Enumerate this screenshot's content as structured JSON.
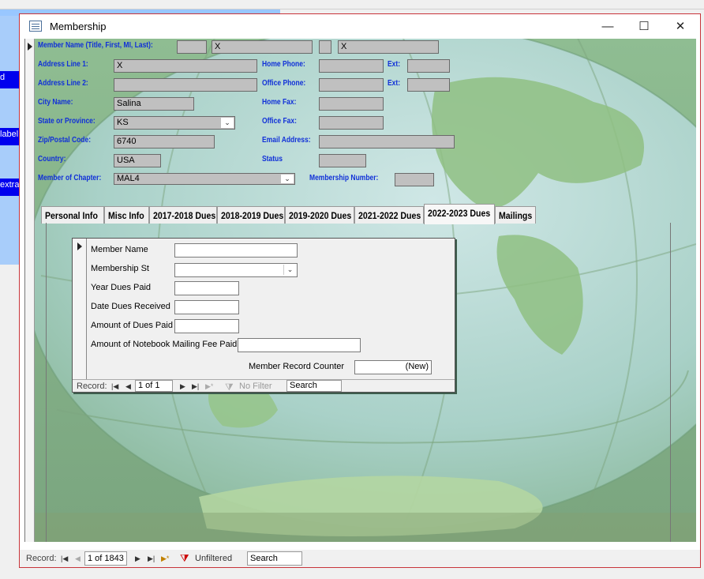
{
  "background_app": {
    "labels": [
      "d",
      "label",
      "extra"
    ]
  },
  "window": {
    "title": "Membership",
    "icon": "form-icon",
    "controls": {
      "minimize": "—",
      "maximize": "☐",
      "close": "✕"
    }
  },
  "form": {
    "fields": {
      "member_name_label": "Member Name (Title, First, MI, Last):",
      "member_name_values": [
        "",
        "X",
        "",
        "X"
      ],
      "address1_label": "Address Line 1:",
      "address1_value": "X",
      "address2_label": "Address Line 2:",
      "address2_value": "",
      "city_label": "City Name:",
      "city_value": "Salina",
      "state_label": "State or Province:",
      "state_value": "KS",
      "zip_label": "Zip/Postal Code:",
      "zip_value": "6740",
      "country_label": "Country:",
      "country_value": "USA",
      "chapter_label": "Member of Chapter:",
      "chapter_value": "MAL4",
      "home_phone_label": "Home Phone:",
      "home_phone_value": "",
      "ext_label": "Ext:",
      "home_ext_value": "",
      "office_phone_label": "Office Phone:",
      "office_phone_value": "",
      "office_ext_value": "",
      "home_fax_label": "Home Fax:",
      "home_fax_value": "",
      "office_fax_label": "Office Fax:",
      "office_fax_value": "",
      "email_label": "Email Address:",
      "email_value": "",
      "status_label": "Status",
      "status_value": "",
      "membership_number_label": "Membership Number:",
      "membership_number_value": ""
    },
    "tabs": [
      {
        "label": "Personal Info"
      },
      {
        "label": "Misc Info"
      },
      {
        "label": "2017-2018 Dues"
      },
      {
        "label": "2018-2019 Dues"
      },
      {
        "label": "2019-2020 Dues"
      },
      {
        "label": "2021-2022 Dues"
      },
      {
        "label": "2022-2023 Dues"
      },
      {
        "label": "Mailings"
      }
    ],
    "active_tab": "2022-2023 Dues",
    "subform": {
      "member_name_label": "Member Name",
      "member_name_value": "",
      "membership_status_label": "Membership St",
      "membership_status_value": "",
      "year_dues_paid_label": "Year Dues Paid",
      "year_dues_paid_value": "",
      "date_dues_received_label": "Date Dues Received",
      "date_dues_received_value": "",
      "amount_dues_paid_label": "Amount of Dues Paid",
      "amount_dues_paid_value": "",
      "notebook_fee_label": "Amount of Notebook Mailing Fee Paid",
      "notebook_fee_value": "",
      "record_counter_label": "Member Record Counter",
      "record_counter_value": "(New)",
      "nav": {
        "record_label": "Record:",
        "position": "1 of 1",
        "filter": "No Filter",
        "search": "Search"
      }
    }
  },
  "main_nav": {
    "record_label": "Record:",
    "position": "1 of 1843",
    "filter": "Unfiltered",
    "search": "Search"
  },
  "colors": {
    "label_blue": "#1030d8",
    "field_gray": "#c0c0c0",
    "form_green": "#9ec7a8",
    "window_border": "#c8343a"
  }
}
